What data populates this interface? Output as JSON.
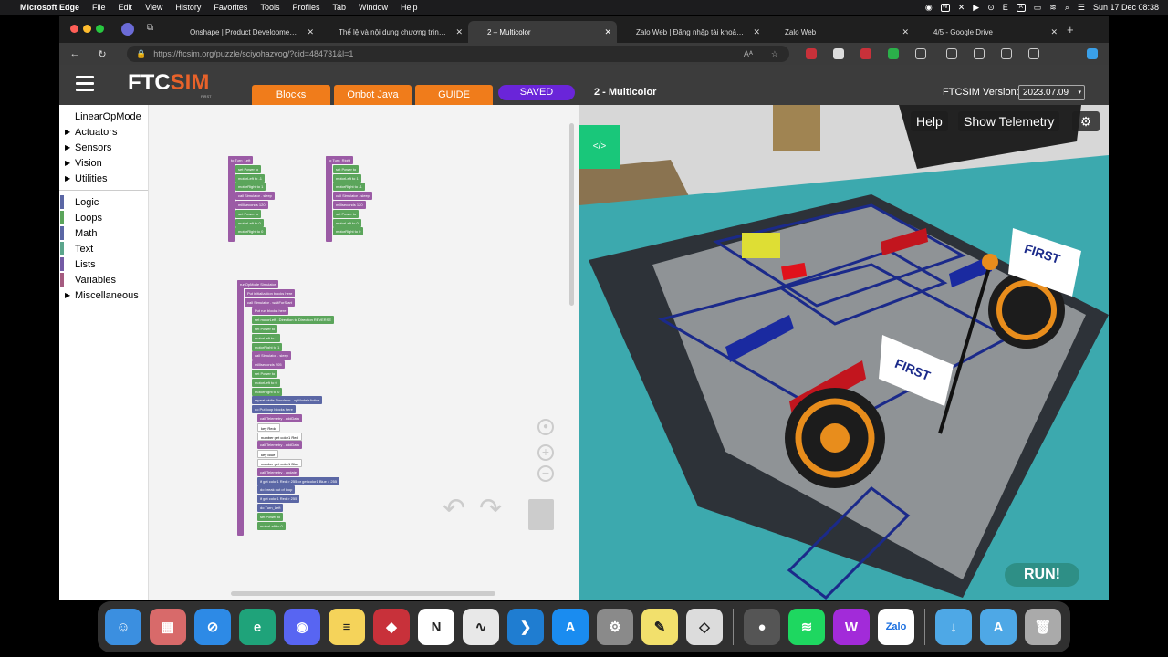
{
  "menubar": {
    "app": "Microsoft Edge",
    "items": [
      "File",
      "Edit",
      "View",
      "History",
      "Favorites",
      "Tools",
      "Profiles",
      "Tab",
      "Window",
      "Help"
    ],
    "clock": "Sun 17 Dec  08:38",
    "input_letter": "E"
  },
  "tabs": [
    {
      "title": "Onshape | Product Developme…",
      "color": "#3a8f4b"
    },
    {
      "title": "Thể lệ và nội dung chương trìn…",
      "color": "#4a6fd1"
    },
    {
      "title": "2 – Multicolor",
      "color": "#444"
    },
    {
      "title": "Zalo Web | Đăng nhập tài khoả…",
      "color": "#888"
    },
    {
      "title": "Zalo Web",
      "color": "#b0485a"
    },
    {
      "title": "4/5 - Google Drive",
      "color": "#3a8f4b"
    }
  ],
  "url": "https://ftcsim.org/puzzle/sciyohazvog/?cid=484731&l=1",
  "ftc": {
    "logo_ftc": "FTC",
    "logo_sim": "SIM",
    "logo_sub": "FIRST",
    "tab_blocks": "Blocks",
    "tab_onbot": "Onbot Java",
    "tab_guide": "GUIDE",
    "saved": "SAVED",
    "title": "2 - Multicolor",
    "version_label": "FTCSIM Version:",
    "version": "2023.07.09"
  },
  "toolbox": [
    {
      "label": "LinearOpMode",
      "arrow": false,
      "color": ""
    },
    {
      "label": "Actuators",
      "arrow": true,
      "color": ""
    },
    {
      "label": "Sensors",
      "arrow": true,
      "color": ""
    },
    {
      "label": "Vision",
      "arrow": true,
      "color": ""
    },
    {
      "label": "Utilities",
      "arrow": true,
      "color": ""
    },
    {
      "sep": true
    },
    {
      "label": "Logic",
      "arrow": false,
      "color": "#5b67a5"
    },
    {
      "label": "Loops",
      "arrow": false,
      "color": "#5ba55b"
    },
    {
      "label": "Math",
      "arrow": false,
      "color": "#5b67a5"
    },
    {
      "label": "Text",
      "arrow": false,
      "color": "#5ba58c"
    },
    {
      "label": "Lists",
      "arrow": false,
      "color": "#745ba5"
    },
    {
      "label": "Variables",
      "arrow": false,
      "color": "#a55b80"
    },
    {
      "label": "Miscellaneous",
      "arrow": true,
      "color": ""
    }
  ],
  "blocks": {
    "turn_left": [
      "to Turn_Left",
      "set Power to",
      "motorLeft to -1",
      "motorRight to 1",
      "call Simulator . sleep",
      "milliseconds 120",
      "set Power to",
      "motorLeft to 0",
      "motorRight to 0"
    ],
    "turn_right": [
      "to Turn_Right",
      "set Power to",
      "motorLeft to 1",
      "motorRight to -1",
      "call Simulator . sleep",
      "milliseconds 120",
      "set Power to",
      "motorLeft to 0",
      "motorRight to 0"
    ],
    "main": [
      "runOpMode Simulator",
      "Put initialization blocks here",
      "call Simulator . waitForStart",
      "Put run blocks here",
      "set motorLeft . Direction to Direction REVERSE",
      "set Power to",
      "motorLeft to 1",
      "motorRight to 1",
      "call Simulator . sleep",
      "milliseconds 205",
      "set Power to",
      "motorLeft to 0",
      "motorRight to 0",
      "repeat while Simulator . opModeIsActive",
      "do Put loop blocks here",
      "call Telemetry . addData",
      "key Redd",
      "number get color1 Red",
      "call Telemetry . addData",
      "key Blue",
      "number get color1 Blue",
      "call Telemetry . update",
      "if get color1 Red > 255 or get color1 Blue > 255",
      "do break out of loop",
      "if get color1 Red > 255",
      "do Turn_Left",
      "set Power to",
      "motorLeft to 0"
    ]
  },
  "sim": {
    "help": "Help",
    "telemetry": "Show Telemetry",
    "run": "RUN!",
    "sign": "FIRST"
  },
  "dock": [
    {
      "name": "finder",
      "label": "☺",
      "color": "#3b8fe0"
    },
    {
      "name": "launchpad",
      "label": "▦",
      "color": "#d86a6a"
    },
    {
      "name": "safari",
      "label": "⊘",
      "color": "#2d8ae6"
    },
    {
      "name": "edge",
      "label": "e",
      "color": "#1fa37a"
    },
    {
      "name": "discord",
      "label": "◉",
      "color": "#5865f2"
    },
    {
      "name": "notes",
      "label": "≡",
      "color": "#f5d35a"
    },
    {
      "name": "pdf",
      "label": "◆",
      "color": "#c8313a"
    },
    {
      "name": "notion",
      "label": "N",
      "color": "#ffffff"
    },
    {
      "name": "freeform",
      "label": "∿",
      "color": "#e8e8e8"
    },
    {
      "name": "vscode",
      "label": "❯",
      "color": "#1f7dd1"
    },
    {
      "name": "appstore",
      "label": "A",
      "color": "#1a8cf0"
    },
    {
      "name": "settings",
      "label": "⚙",
      "color": "#8a8a8a"
    },
    {
      "name": "stickies",
      "label": "✎",
      "color": "#f2e06c"
    },
    {
      "name": "roblox",
      "label": "◇",
      "color": "#dcdcdc"
    },
    {
      "sep": true
    },
    {
      "name": "app-food",
      "label": "●",
      "color": "#555555"
    },
    {
      "name": "spotify",
      "label": "≋",
      "color": "#1ed760"
    },
    {
      "name": "app-w",
      "label": "W",
      "color": "#a22bd9"
    },
    {
      "name": "zalo",
      "label": "Zalo",
      "color": "#ffffff"
    },
    {
      "sep": true
    },
    {
      "name": "downloads",
      "label": "↓",
      "color": "#4ea8e6"
    },
    {
      "name": "apps-folder",
      "label": "A",
      "color": "#4ea8e6"
    },
    {
      "name": "trash",
      "label": "🗑",
      "color": "#aaaaaa"
    }
  ]
}
